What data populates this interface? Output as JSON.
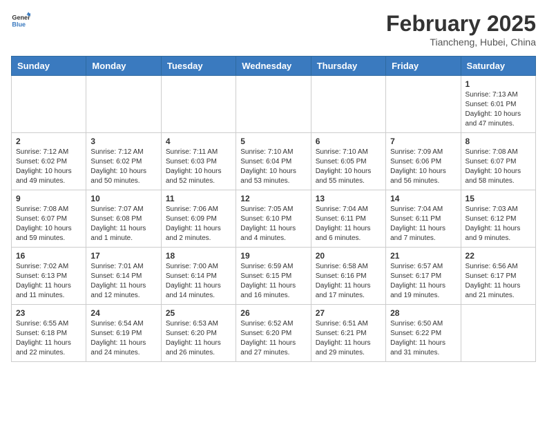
{
  "header": {
    "logo_line1": "General",
    "logo_line2": "Blue",
    "month": "February 2025",
    "location": "Tiancheng, Hubei, China"
  },
  "days_of_week": [
    "Sunday",
    "Monday",
    "Tuesday",
    "Wednesday",
    "Thursday",
    "Friday",
    "Saturday"
  ],
  "weeks": [
    [
      {
        "day": "",
        "info": ""
      },
      {
        "day": "",
        "info": ""
      },
      {
        "day": "",
        "info": ""
      },
      {
        "day": "",
        "info": ""
      },
      {
        "day": "",
        "info": ""
      },
      {
        "day": "",
        "info": ""
      },
      {
        "day": "1",
        "info": "Sunrise: 7:13 AM\nSunset: 6:01 PM\nDaylight: 10 hours and 47 minutes."
      }
    ],
    [
      {
        "day": "2",
        "info": "Sunrise: 7:12 AM\nSunset: 6:02 PM\nDaylight: 10 hours and 49 minutes."
      },
      {
        "day": "3",
        "info": "Sunrise: 7:12 AM\nSunset: 6:02 PM\nDaylight: 10 hours and 50 minutes."
      },
      {
        "day": "4",
        "info": "Sunrise: 7:11 AM\nSunset: 6:03 PM\nDaylight: 10 hours and 52 minutes."
      },
      {
        "day": "5",
        "info": "Sunrise: 7:10 AM\nSunset: 6:04 PM\nDaylight: 10 hours and 53 minutes."
      },
      {
        "day": "6",
        "info": "Sunrise: 7:10 AM\nSunset: 6:05 PM\nDaylight: 10 hours and 55 minutes."
      },
      {
        "day": "7",
        "info": "Sunrise: 7:09 AM\nSunset: 6:06 PM\nDaylight: 10 hours and 56 minutes."
      },
      {
        "day": "8",
        "info": "Sunrise: 7:08 AM\nSunset: 6:07 PM\nDaylight: 10 hours and 58 minutes."
      }
    ],
    [
      {
        "day": "9",
        "info": "Sunrise: 7:08 AM\nSunset: 6:07 PM\nDaylight: 10 hours and 59 minutes."
      },
      {
        "day": "10",
        "info": "Sunrise: 7:07 AM\nSunset: 6:08 PM\nDaylight: 11 hours and 1 minute."
      },
      {
        "day": "11",
        "info": "Sunrise: 7:06 AM\nSunset: 6:09 PM\nDaylight: 11 hours and 2 minutes."
      },
      {
        "day": "12",
        "info": "Sunrise: 7:05 AM\nSunset: 6:10 PM\nDaylight: 11 hours and 4 minutes."
      },
      {
        "day": "13",
        "info": "Sunrise: 7:04 AM\nSunset: 6:11 PM\nDaylight: 11 hours and 6 minutes."
      },
      {
        "day": "14",
        "info": "Sunrise: 7:04 AM\nSunset: 6:11 PM\nDaylight: 11 hours and 7 minutes."
      },
      {
        "day": "15",
        "info": "Sunrise: 7:03 AM\nSunset: 6:12 PM\nDaylight: 11 hours and 9 minutes."
      }
    ],
    [
      {
        "day": "16",
        "info": "Sunrise: 7:02 AM\nSunset: 6:13 PM\nDaylight: 11 hours and 11 minutes."
      },
      {
        "day": "17",
        "info": "Sunrise: 7:01 AM\nSunset: 6:14 PM\nDaylight: 11 hours and 12 minutes."
      },
      {
        "day": "18",
        "info": "Sunrise: 7:00 AM\nSunset: 6:14 PM\nDaylight: 11 hours and 14 minutes."
      },
      {
        "day": "19",
        "info": "Sunrise: 6:59 AM\nSunset: 6:15 PM\nDaylight: 11 hours and 16 minutes."
      },
      {
        "day": "20",
        "info": "Sunrise: 6:58 AM\nSunset: 6:16 PM\nDaylight: 11 hours and 17 minutes."
      },
      {
        "day": "21",
        "info": "Sunrise: 6:57 AM\nSunset: 6:17 PM\nDaylight: 11 hours and 19 minutes."
      },
      {
        "day": "22",
        "info": "Sunrise: 6:56 AM\nSunset: 6:17 PM\nDaylight: 11 hours and 21 minutes."
      }
    ],
    [
      {
        "day": "23",
        "info": "Sunrise: 6:55 AM\nSunset: 6:18 PM\nDaylight: 11 hours and 22 minutes."
      },
      {
        "day": "24",
        "info": "Sunrise: 6:54 AM\nSunset: 6:19 PM\nDaylight: 11 hours and 24 minutes."
      },
      {
        "day": "25",
        "info": "Sunrise: 6:53 AM\nSunset: 6:20 PM\nDaylight: 11 hours and 26 minutes."
      },
      {
        "day": "26",
        "info": "Sunrise: 6:52 AM\nSunset: 6:20 PM\nDaylight: 11 hours and 27 minutes."
      },
      {
        "day": "27",
        "info": "Sunrise: 6:51 AM\nSunset: 6:21 PM\nDaylight: 11 hours and 29 minutes."
      },
      {
        "day": "28",
        "info": "Sunrise: 6:50 AM\nSunset: 6:22 PM\nDaylight: 11 hours and 31 minutes."
      },
      {
        "day": "",
        "info": ""
      }
    ]
  ]
}
